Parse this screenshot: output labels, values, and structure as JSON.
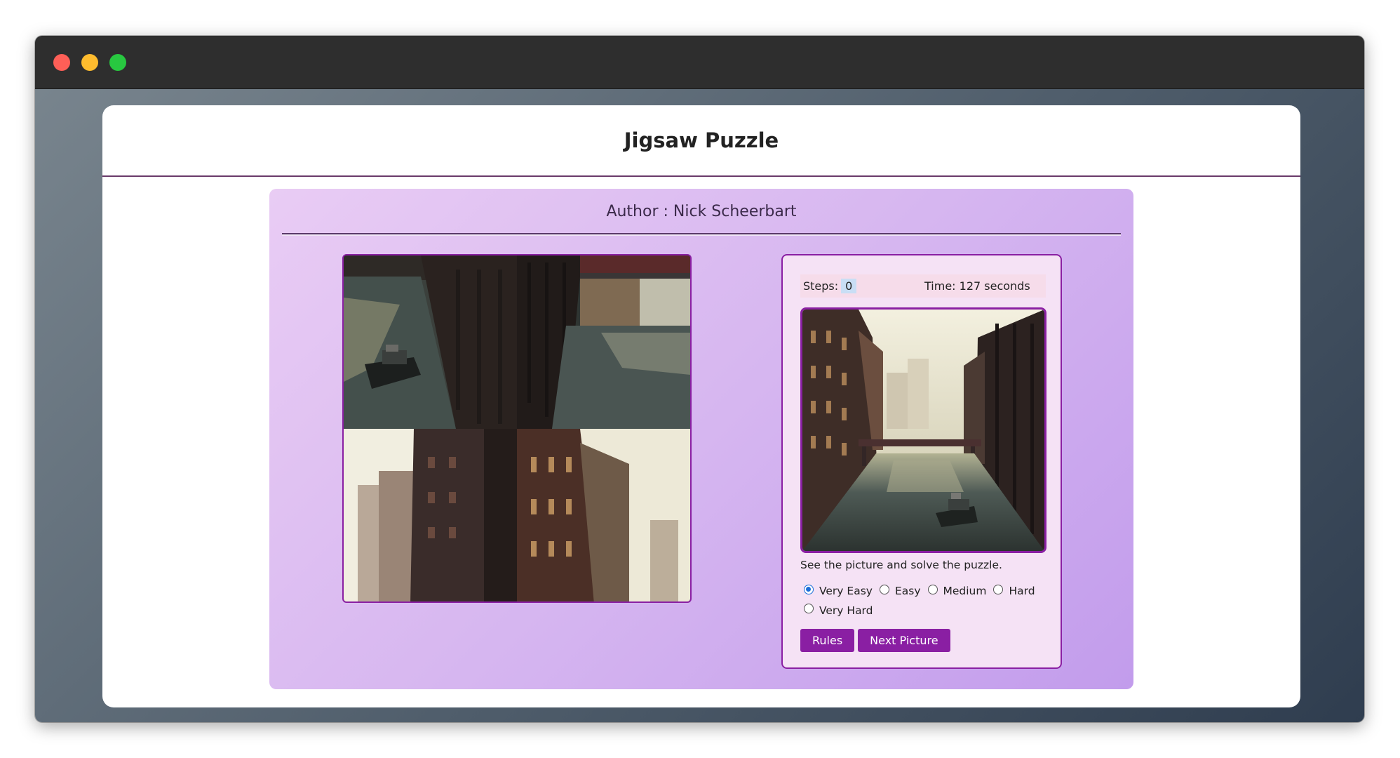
{
  "app": {
    "title": "Jigsaw Puzzle",
    "author": "Author : Nick Scheerbart"
  },
  "stats": {
    "steps_label": "Steps:",
    "steps_value": "0",
    "time_text": "Time: 127 seconds"
  },
  "hint": "See the picture and solve the puzzle.",
  "levels": [
    {
      "label": "Very Easy",
      "selected": true
    },
    {
      "label": "Easy",
      "selected": false
    },
    {
      "label": "Medium",
      "selected": false
    },
    {
      "label": "Hard",
      "selected": false
    },
    {
      "label": "Very Hard",
      "selected": false
    }
  ],
  "buttons": {
    "rules": "Rules",
    "next": "Next Picture"
  },
  "colors": {
    "accent": "#8a1fa3",
    "panel_start": "#e9ccf4",
    "panel_end": "#c29cec"
  },
  "icons": [
    "close-window-icon",
    "minimize-window-icon",
    "maximize-window-icon"
  ]
}
